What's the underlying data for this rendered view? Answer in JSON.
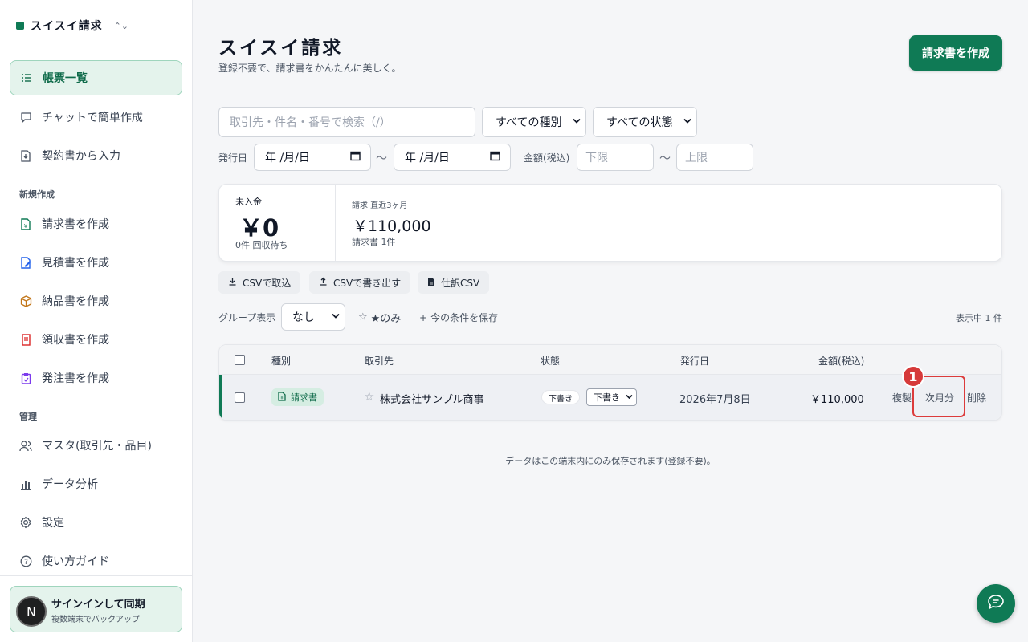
{
  "app": {
    "name": "スイスイ請求",
    "accent": "#0f7a55"
  },
  "sidebar": {
    "items": [
      {
        "label": "帳票一覧",
        "icon": "list-icon"
      },
      {
        "label": "チャットで簡単作成",
        "icon": "chat-icon"
      },
      {
        "label": "契約書から入力",
        "icon": "file-import-icon"
      }
    ],
    "new_section": "新規作成",
    "new_items": [
      {
        "label": "請求書を作成",
        "icon": "invoice-icon"
      },
      {
        "label": "見積書を作成",
        "icon": "quote-icon"
      },
      {
        "label": "納品書を作成",
        "icon": "box-icon"
      },
      {
        "label": "領収書を作成",
        "icon": "receipt-icon"
      },
      {
        "label": "発注書を作成",
        "icon": "clipboard-icon"
      }
    ],
    "admin_section": "管理",
    "admin_items": [
      {
        "label": "マスタ(取引先・品目)",
        "icon": "users-icon"
      },
      {
        "label": "データ分析",
        "icon": "bar-chart-icon"
      },
      {
        "label": "設定",
        "icon": "gear-icon"
      },
      {
        "label": "使い方ガイド",
        "icon": "help-icon"
      }
    ],
    "signin": {
      "avatar": "N",
      "title": "サインインして同期",
      "subtitle": "複数端末でバックアップ"
    }
  },
  "header": {
    "title": "スイスイ請求",
    "subtitle": "登録不要で、請求書をかんたんに美しく。",
    "create_button": "請求書を作成"
  },
  "filters": {
    "search_placeholder": "取引先・件名・番号で検索（/）",
    "type_select": "すべての種別",
    "status_select": "すべての状態",
    "issue_date_label": "発行日",
    "date_from": "年 /月/日",
    "date_to": "年 /月/日",
    "amount_label": "金額(税込)",
    "amount_min_placeholder": "下限",
    "amount_max_placeholder": "上限",
    "range_sep": "～"
  },
  "summary": {
    "unpaid_label": "未入金",
    "unpaid_amount": "￥0",
    "unpaid_note": "0件 回収待ち",
    "recent_label": "請求 直近3ヶ月",
    "recent_amount": "￥110,000",
    "recent_note": "請求書 1件"
  },
  "actions": {
    "import_csv": "CSVで取込",
    "export_csv": "CSVで書き出す",
    "journal_csv": "仕訳CSV"
  },
  "grouping": {
    "label": "グループ表示",
    "value": "なし",
    "starred_only": "★のみ",
    "save_filter": "今の条件を保存",
    "count_text": "表示中 1 件"
  },
  "table": {
    "headers": {
      "type": "種別",
      "client": "取引先",
      "status": "状態",
      "issue_date": "発行日",
      "amount": "金額(税込)"
    },
    "rows": [
      {
        "type": "請求書",
        "client": "株式会社サンプル商事",
        "status": "下書き",
        "status_select": "下書き",
        "issue_date": "2026年7月8日",
        "amount": "￥110,000",
        "actions": {
          "duplicate": "複製",
          "next_month": "次月分",
          "delete": "削除"
        }
      }
    ]
  },
  "annotation": {
    "marker": "1"
  },
  "footer_note": "データはこの端末内にのみ保存されます(登録不要)。"
}
